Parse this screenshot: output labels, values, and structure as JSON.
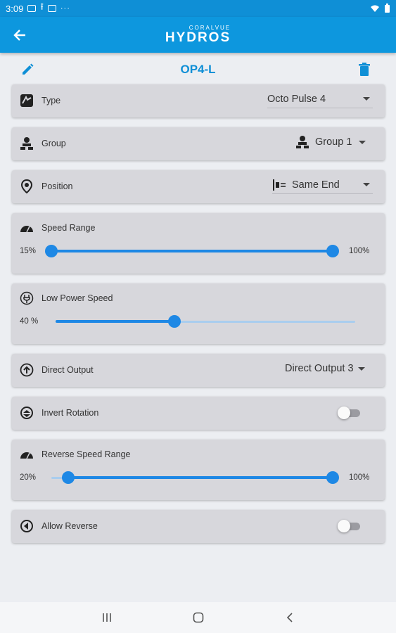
{
  "statusbar": {
    "time": "3:09",
    "more": "···"
  },
  "appbar": {
    "brand_small": "CORALVUE",
    "brand_big": "HYDROS",
    "back_icon": "arrow-left-icon"
  },
  "header": {
    "title": "OP4-L",
    "edit_icon": "pencil-icon",
    "delete_icon": "trash-icon"
  },
  "type": {
    "label": "Type",
    "value": "Octo Pulse 4"
  },
  "group": {
    "label": "Group",
    "value": "Group 1"
  },
  "position": {
    "label": "Position",
    "value": "Same End"
  },
  "speed_range": {
    "label": "Speed Range",
    "min_label": "15%",
    "max_label": "100%",
    "low": 15,
    "high": 100
  },
  "low_power_speed": {
    "label": "Low Power Speed",
    "value_label": "40 %",
    "value": 40
  },
  "direct_output": {
    "label": "Direct Output",
    "value": "Direct Output 3"
  },
  "invert_rotation": {
    "label": "Invert Rotation",
    "enabled": false
  },
  "reverse_speed_range": {
    "label": "Reverse Speed Range",
    "min_label": "20%",
    "max_label": "100%",
    "low": 20,
    "high": 100
  },
  "allow_reverse": {
    "label": "Allow Reverse",
    "enabled": false
  },
  "colors": {
    "accent": "#0d97de",
    "slider": "#1e88e5",
    "card": "#d7d7dc"
  }
}
